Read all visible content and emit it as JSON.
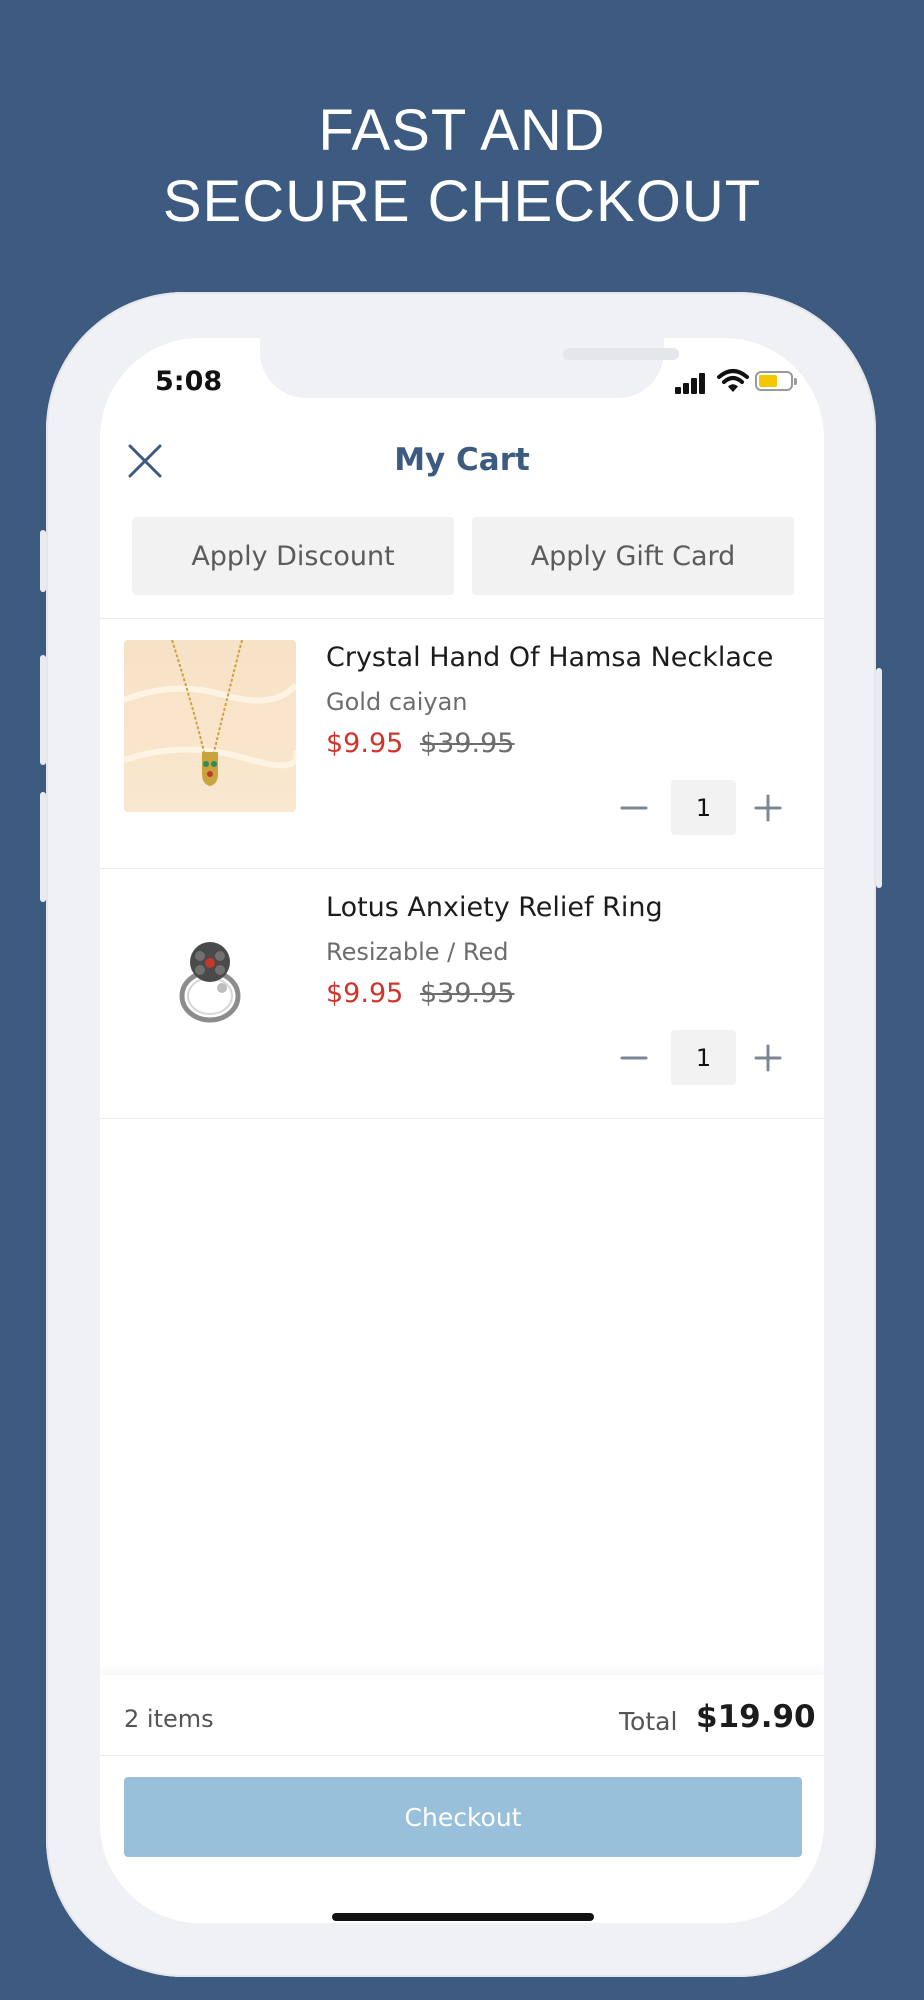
{
  "promo": {
    "line1": "FAST AND",
    "line2": "SECURE CHECKOUT",
    "background": "#3d5a80"
  },
  "status_bar": {
    "time": "5:08",
    "icons": [
      "signal-icon",
      "wifi-icon",
      "battery-icon"
    ],
    "battery_color": "#f4c700"
  },
  "header": {
    "title": "My Cart",
    "close_icon": "close-icon"
  },
  "actions": {
    "discount_label": "Apply Discount",
    "gift_card_label": "Apply Gift Card"
  },
  "items": [
    {
      "name": "Crystal Hand Of Hamsa Necklace",
      "variant": "Gold caiyan",
      "sale_price": "$9.95",
      "original_price": "$39.95",
      "quantity": "1"
    },
    {
      "name": "Lotus Anxiety Relief Ring",
      "variant": "Resizable / Red",
      "sale_price": "$9.95",
      "original_price": "$39.95",
      "quantity": "1"
    }
  ],
  "footer": {
    "items_count": "2 items",
    "total_label": "Total",
    "total_value": "$19.90",
    "checkout_label": "Checkout",
    "checkout_color": "#99c0da"
  },
  "colors": {
    "accent": "#3d5a80",
    "sale_price": "#d0342c"
  }
}
